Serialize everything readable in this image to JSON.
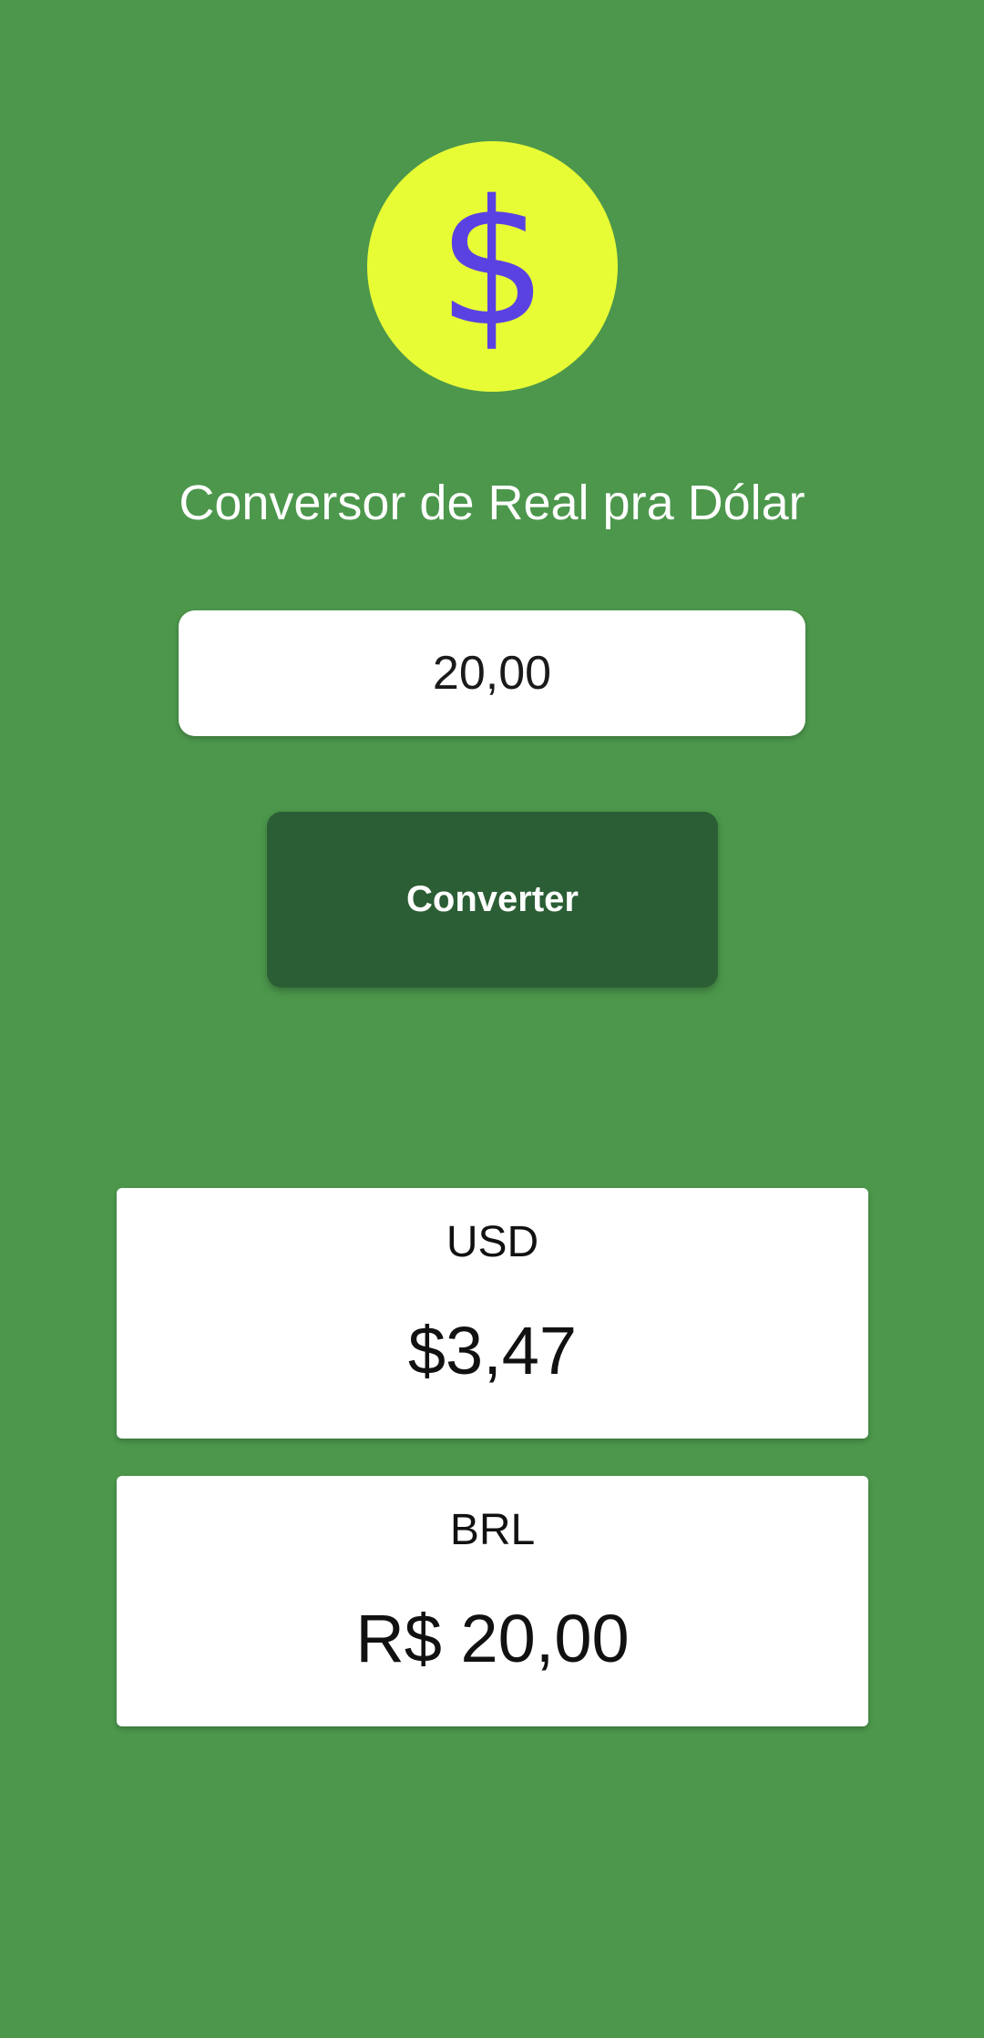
{
  "logo": {
    "glyph": "$",
    "icon": "dollar-icon",
    "circle_color": "#e8fc35",
    "glyph_color": "#5a42e2"
  },
  "header": {
    "title": "Conversor de Real pra Dólar"
  },
  "form": {
    "amount_value": "20,00",
    "convert_label": "Converter"
  },
  "results": {
    "usd": {
      "label": "USD",
      "value": "$3,47"
    },
    "brl": {
      "label": "BRL",
      "value": "R$ 20,00"
    }
  },
  "colors": {
    "background": "#4c974c",
    "button": "#2b5e35",
    "card": "#ffffff"
  }
}
